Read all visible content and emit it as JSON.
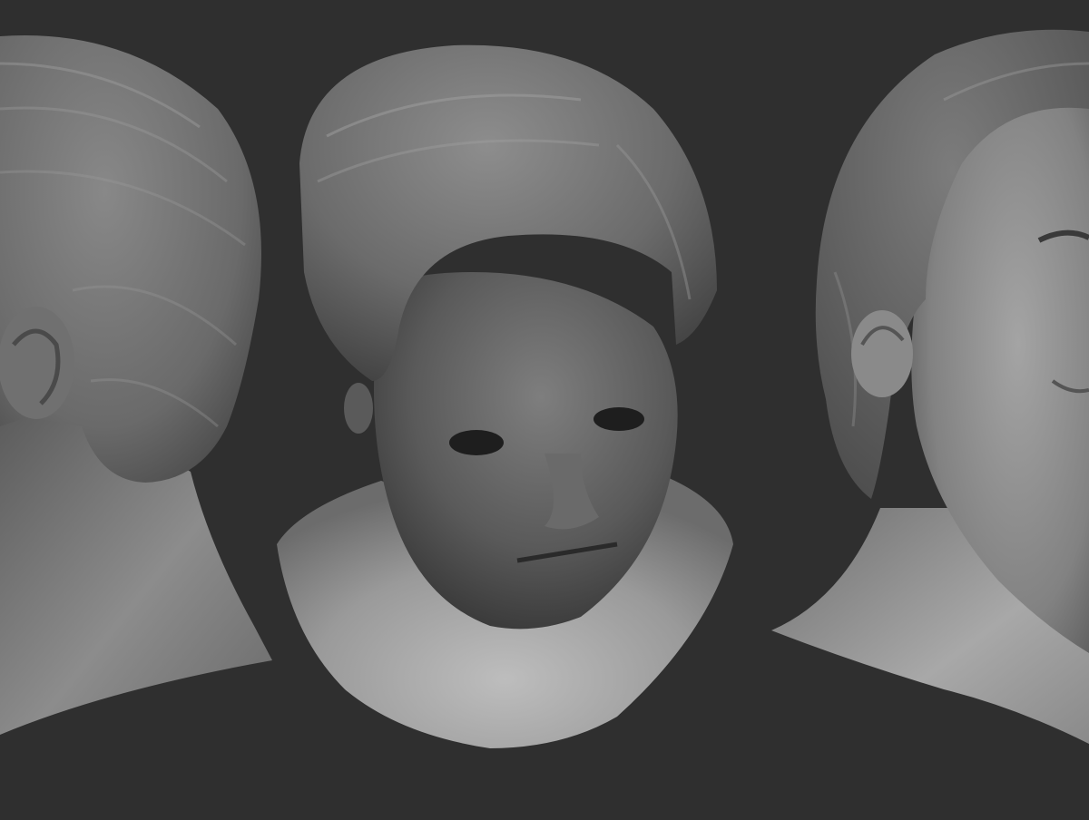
{
  "scene": {
    "background_color": "#2f2f2f",
    "clay_color": "#8a8a8a",
    "views": [
      {
        "id": "back-three-quarter",
        "label": ""
      },
      {
        "id": "front-looking-down",
        "label": ""
      },
      {
        "id": "side-three-quarter",
        "label": ""
      }
    ]
  }
}
